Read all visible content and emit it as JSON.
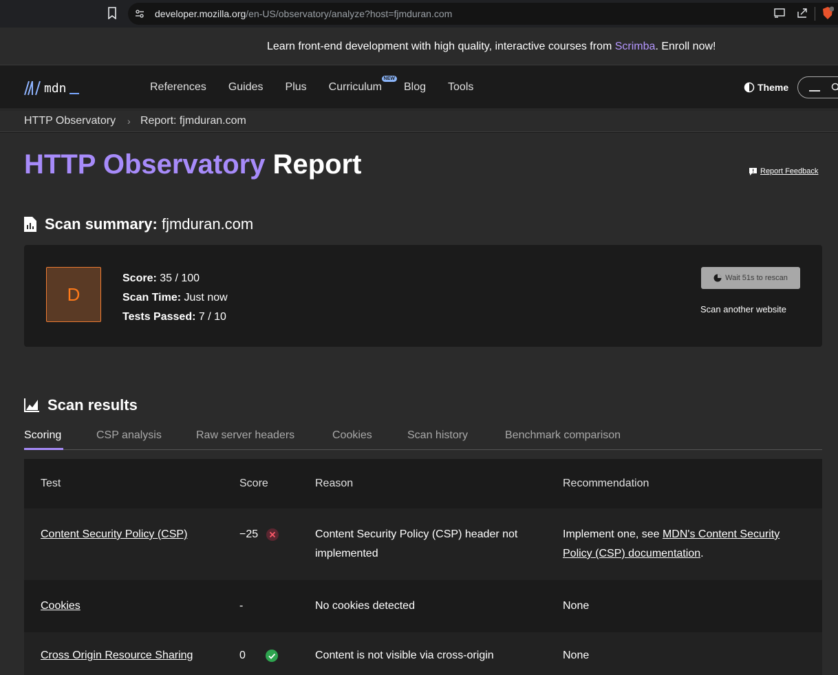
{
  "browser": {
    "url_host": "developer.mozilla.org",
    "url_path": "/en-US/observatory/analyze?host=fjmduran.com"
  },
  "banner": {
    "text_before": "Learn front-end development with high quality, interactive courses from ",
    "link": "Scrimba",
    "text_after": ". Enroll now!"
  },
  "nav": {
    "logo_text": "mdn",
    "items": [
      {
        "label": "References"
      },
      {
        "label": "Guides"
      },
      {
        "label": "Plus"
      },
      {
        "label": "Curriculum",
        "badge": "NEW"
      },
      {
        "label": "Blog"
      },
      {
        "label": "Tools"
      }
    ],
    "theme_label": "Theme"
  },
  "breadcrumb": {
    "items": [
      "HTTP Observatory",
      "Report: fjmduran.com"
    ]
  },
  "page": {
    "title_accent": "HTTP Observatory",
    "title_rest": " Report",
    "feedback_label": "Report Feedback"
  },
  "summary": {
    "heading_label": "Scan summary:",
    "heading_host": " fjmduran.com",
    "grade": "D",
    "score_label": "Score:",
    "score_value": " 35 / 100",
    "time_label": "Scan Time:",
    "time_value": " Just now",
    "tests_label": "Tests Passed:",
    "tests_value": " 7 / 10",
    "rescan_label": "Wait 51s to rescan",
    "scan_another_label": "Scan another website"
  },
  "results": {
    "heading": "Scan results",
    "tabs": [
      "Scoring",
      "CSP analysis",
      "Raw server headers",
      "Cookies",
      "Scan history",
      "Benchmark comparison"
    ],
    "active_tab": "Scoring",
    "columns": [
      "Test",
      "Score",
      "Reason",
      "Recommendation"
    ],
    "rows": [
      {
        "test": "Content Security Policy (CSP)",
        "score": "−25",
        "status": "fail",
        "reason": "Content Security Policy (CSP) header not implemented",
        "rec_before": "Implement one, see ",
        "rec_link": "MDN's Content Security Policy (CSP) documentation",
        "rec_after": "."
      },
      {
        "test": "Cookies",
        "score": "-",
        "status": "none",
        "reason": "No cookies detected",
        "rec_before": "None"
      },
      {
        "test": "Cross Origin Resource Sharing",
        "score": "0",
        "status": "pass",
        "reason": "Content is not visible via cross-origin",
        "rec_before": "None"
      }
    ]
  },
  "colors": {
    "accent_purple": "#a78bfa",
    "grade_orange": "#ff7a1a",
    "fail_red": "#e0354a",
    "pass_green": "#2ea44f"
  }
}
